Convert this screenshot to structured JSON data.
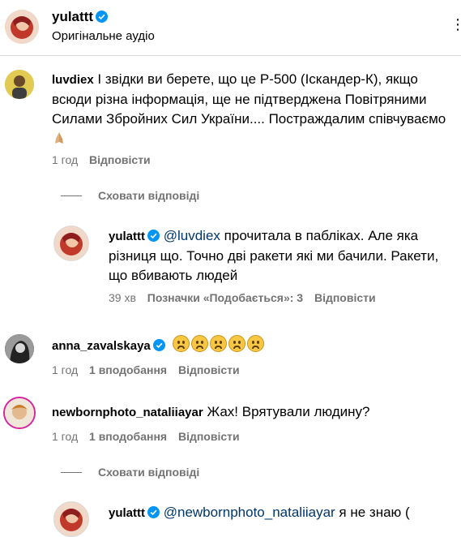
{
  "post": {
    "author": "yulattt",
    "audio": "Оригінальне аудіо",
    "more": "⋮"
  },
  "comments": [
    {
      "user": "luvdiex",
      "text": "І звідки ви берете, що це Р-500 (Іскандер-К), якщо всюди різна інформація, ще не підтверджена Повітряними Силами Збройних Сил України.... Постраждалим співчуваємо",
      "time": "1 год",
      "reply": "Відповісти",
      "hide_replies": "Сховати відповіді",
      "replies": [
        {
          "user": "yulattt",
          "mention": "@luvdiex",
          "text": "прочитала в пабліках. Але яка різниця що. Точно дві ракети які ми бачили. Ракети, що вбивають людей",
          "time": "39 хв",
          "likes": "Позначки «Подобається»: 3",
          "reply": "Відповісти"
        }
      ]
    },
    {
      "user": "anna_zavalskaya",
      "emoji_count": 5,
      "time": "1 год",
      "likes": "1 вподобання",
      "reply": "Відповісти"
    },
    {
      "user": "newbornphoto_nataliiayar",
      "text": "Жах! Врятували людину?",
      "time": "1 год",
      "likes": "1 вподобання",
      "reply": "Відповісти",
      "hide_replies": "Сховати відповіді",
      "replies": [
        {
          "user": "yulattt",
          "mention": "@newbornphoto_nataliiayar",
          "text": "я не знаю ("
        }
      ]
    }
  ],
  "colors": {
    "meta_gray": "#737373",
    "mention_blue": "#00376b",
    "verified_blue": "#0095f6",
    "story_ring": "#d6249f"
  }
}
